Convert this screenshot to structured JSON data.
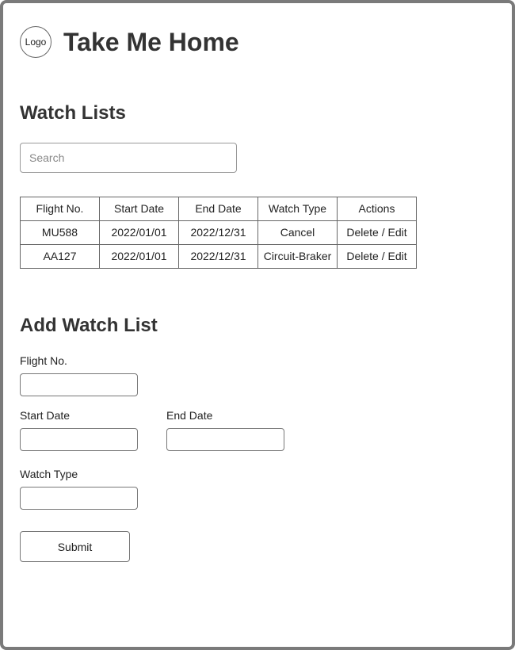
{
  "header": {
    "logo_label": "Logo",
    "app_title": "Take Me Home"
  },
  "watch_lists": {
    "title": "Watch Lists",
    "search": {
      "placeholder": "Search",
      "value": ""
    },
    "table": {
      "columns": [
        "Flight No.",
        "Start Date",
        "End Date",
        "Watch Type",
        "Actions"
      ],
      "rows": [
        [
          "MU588",
          "2022/01/01",
          "2022/12/31",
          "Cancel",
          "Delete / Edit"
        ],
        [
          "AA127",
          "2022/01/01",
          "2022/12/31",
          "Circuit-Braker",
          "Delete / Edit"
        ]
      ]
    }
  },
  "add_watch_list": {
    "title": "Add Watch List",
    "flight_no_label": "Flight No.",
    "flight_no_value": "",
    "start_date_label": "Start Date",
    "start_date_value": "",
    "end_date_label": "End Date",
    "end_date_value": "",
    "watch_type_label": "Watch Type",
    "watch_type_value": "",
    "submit_label": "Submit"
  }
}
